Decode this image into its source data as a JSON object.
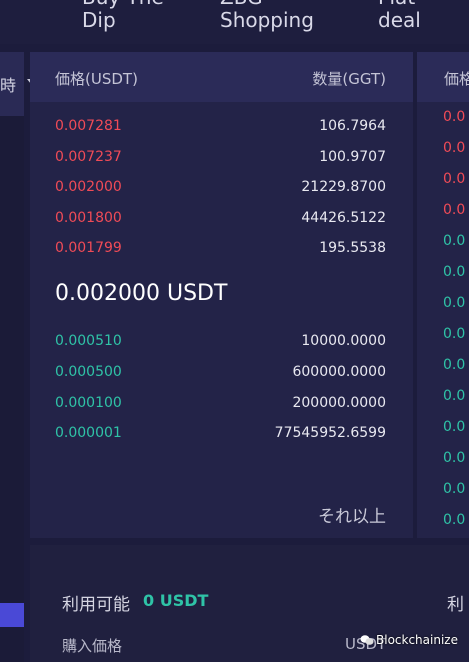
{
  "nav": {
    "items": [
      {
        "line1": "Buy The",
        "line2": "Dip"
      },
      {
        "line1": "ZBG",
        "line2": "Shopping"
      },
      {
        "line1": "Flat",
        "line2": "deal"
      }
    ]
  },
  "left_strip": {
    "selected_label": "時"
  },
  "order_book": {
    "header": {
      "price": "価格(USDT)",
      "quantity": "数量(GGT)"
    },
    "asks": [
      {
        "price": "0.007281",
        "qty": "106.7964"
      },
      {
        "price": "0.007237",
        "qty": "100.9707"
      },
      {
        "price": "0.002000",
        "qty": "21229.8700"
      },
      {
        "price": "0.001800",
        "qty": "44426.5122"
      },
      {
        "price": "0.001799",
        "qty": "195.5538"
      }
    ],
    "last_price": "0.002000 USDT",
    "bids": [
      {
        "price": "0.000510",
        "qty": "10000.0000"
      },
      {
        "price": "0.000500",
        "qty": "600000.0000"
      },
      {
        "price": "0.000100",
        "qty": "200000.0000"
      },
      {
        "price": "0.000001",
        "qty": "77545952.6599"
      }
    ],
    "more_label": "それ以上"
  },
  "right_panel": {
    "header": "価格",
    "prices": [
      "0.0",
      "0.0",
      "0.0",
      "0.0",
      "0.0",
      "0.0",
      "0.0",
      "0.0",
      "0.0",
      "0.0",
      "0.0",
      "0.0",
      "0.0",
      "0.0"
    ]
  },
  "bottom": {
    "available_label": "利用可能",
    "available_value": "0 USDT",
    "available_label_2": "利",
    "buy_price_label": "購入価格",
    "currency": "USDT"
  },
  "watermark": "Blockchainize",
  "colors": {
    "ask": "#f04b57",
    "bid": "#2fc3a7",
    "accent": "#4a49d6",
    "background": "#1c1c3c"
  }
}
